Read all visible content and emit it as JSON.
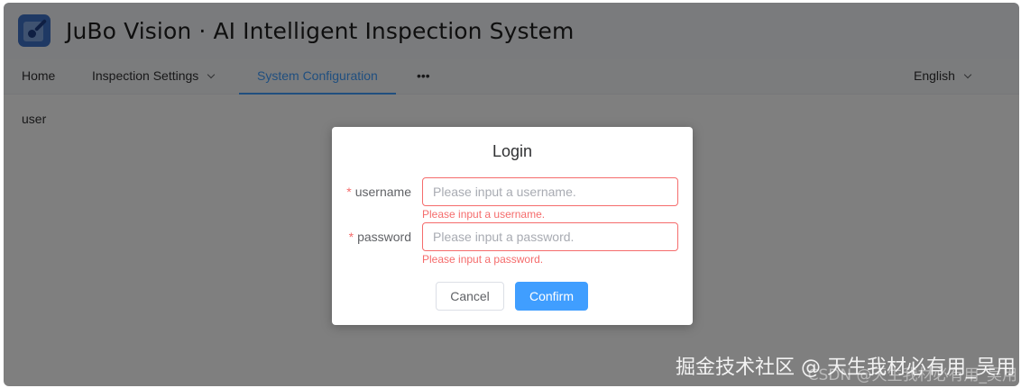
{
  "app": {
    "title": "JuBo Vision  ·  AI Intelligent Inspection System",
    "logo_icon": "inspection-logo-icon"
  },
  "nav": {
    "items": [
      {
        "label": "Home"
      },
      {
        "label": "Inspection Settings",
        "icon": "chevron-down-icon"
      },
      {
        "label": "System Configuration",
        "active": true
      },
      {
        "label": "•••",
        "icon": "more-icon"
      }
    ],
    "language": {
      "label": "English",
      "icon": "chevron-down-icon"
    }
  },
  "content": {
    "label": "user"
  },
  "dialog": {
    "title": "Login",
    "fields": {
      "username": {
        "required_mark": "*",
        "label": "username",
        "value": "",
        "placeholder": "Please input a username.",
        "error": "Please input a username."
      },
      "password": {
        "required_mark": "*",
        "label": "password",
        "value": "",
        "placeholder": "Please input a password.",
        "error": "Please input a password."
      }
    },
    "buttons": {
      "cancel": "Cancel",
      "confirm": "Confirm"
    }
  },
  "watermark": {
    "primary": "掘金技术社区 @ 天生我材必有用_吴用",
    "secondary": "CSDN @天生我材必有用_吴用"
  },
  "colors": {
    "accent": "#409eff",
    "error": "#f56c6c",
    "overlay": "rgba(0,0,0,0.5)",
    "logo": "#3f73c9"
  }
}
